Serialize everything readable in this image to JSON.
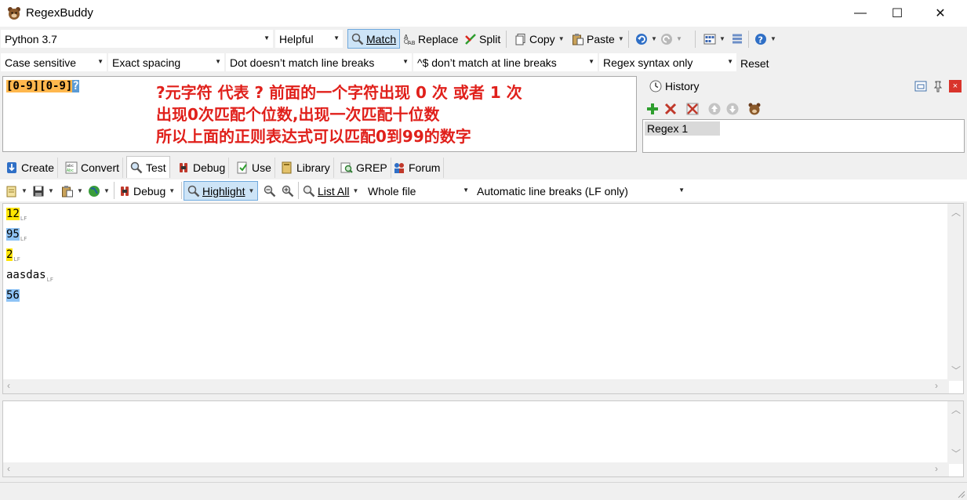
{
  "window": {
    "title": "RegexBuddy",
    "minimize": "—",
    "maximize": "☐",
    "close": "✕"
  },
  "toolbar1": {
    "flavor": "Python 3.7",
    "helpful": "Helpful",
    "match": "Match",
    "replace": "Replace",
    "split": "Split",
    "copy": "Copy",
    "paste": "Paste"
  },
  "toolbar2": {
    "case": "Case sensitive",
    "spacing": "Exact spacing",
    "dot": "Dot doesn’t match line breaks",
    "anchors": "^$ don’t match at line breaks",
    "syntax": "Regex syntax only",
    "reset": "Reset"
  },
  "regex": {
    "part1": "[0-9]",
    "part2": "[0-9]",
    "part3": "?"
  },
  "annotation": {
    "line1": "?元字符 代表 ? 前面的一个字符出现 0 次 或者 1 次",
    "line2": "出现0次匹配个位数,出现一次匹配十位数",
    "line3": "所以上面的正则表达式可以匹配0到99的数字"
  },
  "history": {
    "title": "History",
    "items": [
      "Regex 1"
    ]
  },
  "tabs": [
    {
      "label": "Create"
    },
    {
      "label": "Convert"
    },
    {
      "label": "Test"
    },
    {
      "label": "Debug"
    },
    {
      "label": "Use"
    },
    {
      "label": "Library"
    },
    {
      "label": "GREP"
    },
    {
      "label": "Forum"
    }
  ],
  "test_toolbar": {
    "debug": "Debug",
    "highlight": "Highlight",
    "list_all": "List All",
    "scope": "Whole file",
    "line_breaks": "Automatic line breaks (LF only)"
  },
  "test_lines": [
    {
      "text": "12",
      "highlight": "yellow"
    },
    {
      "text": "95",
      "highlight": "blue"
    },
    {
      "text": "2",
      "highlight": "yellow"
    },
    {
      "text": "aasdas",
      "highlight": "none"
    },
    {
      "text": "56",
      "highlight": "blue"
    }
  ],
  "colors": {
    "match_yellow": "#ffe500",
    "match_blue": "#8ec3f5",
    "annotation_red": "#e0201b",
    "regex_class_bg": "#ffb74d",
    "regex_quantifier_bg": "#5b9bd5"
  }
}
